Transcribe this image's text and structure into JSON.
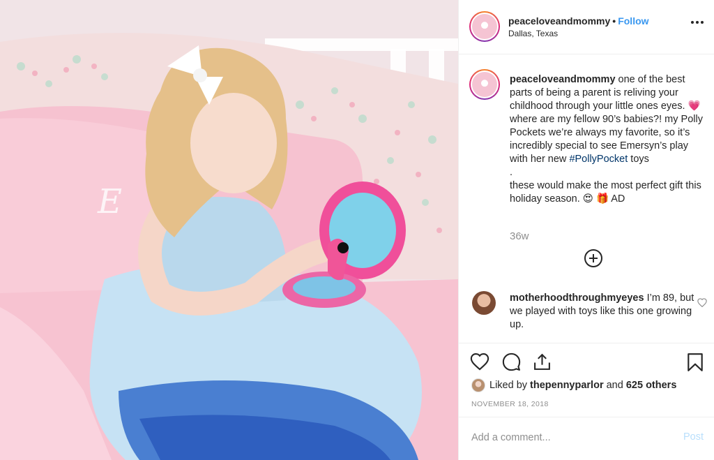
{
  "post": {
    "username": "peaceloveandmommy",
    "follow_label": "Follow",
    "location": "Dallas, Texas",
    "more_label": "More options",
    "photo_alt": "Girl in a pink chair playing with a flamingo Polly Pocket"
  },
  "caption": {
    "username": "peaceloveandmommy",
    "line1": " one of the best parts of being a parent is reliving your childhood through your little ones eyes. ",
    "emoji_heart": "💗",
    "line2": "  where are my fellow 90’s babies?! my Polly Pockets we’re always my favorite, so it’s incredibly special to see Emersyn’s play with her new ",
    "hashtag": "#PollyPocket",
    "line3": " toys",
    "dot": ".",
    "line4": "these would make the most perfect gift this holiday season. ",
    "emoji_end": "😍 🎁",
    "ad": "  AD",
    "time_ago": "36w"
  },
  "comment": {
    "username": "motherhoodthroughmyeyes",
    "text": " I’m 89, but we played with toys like this one growing up."
  },
  "likes": {
    "prefix": "Liked by ",
    "liker": "thepennyparlor",
    "and": " and ",
    "others": "625 others"
  },
  "date": "NOVEMBER 18, 2018",
  "comment_box": {
    "placeholder": "Add a comment...",
    "post_label": "Post"
  },
  "colors": {
    "link_blue": "#3897f0",
    "hashtag_blue": "#003569",
    "muted": "#8e8e8e",
    "post_disabled": "#b9dffc"
  }
}
